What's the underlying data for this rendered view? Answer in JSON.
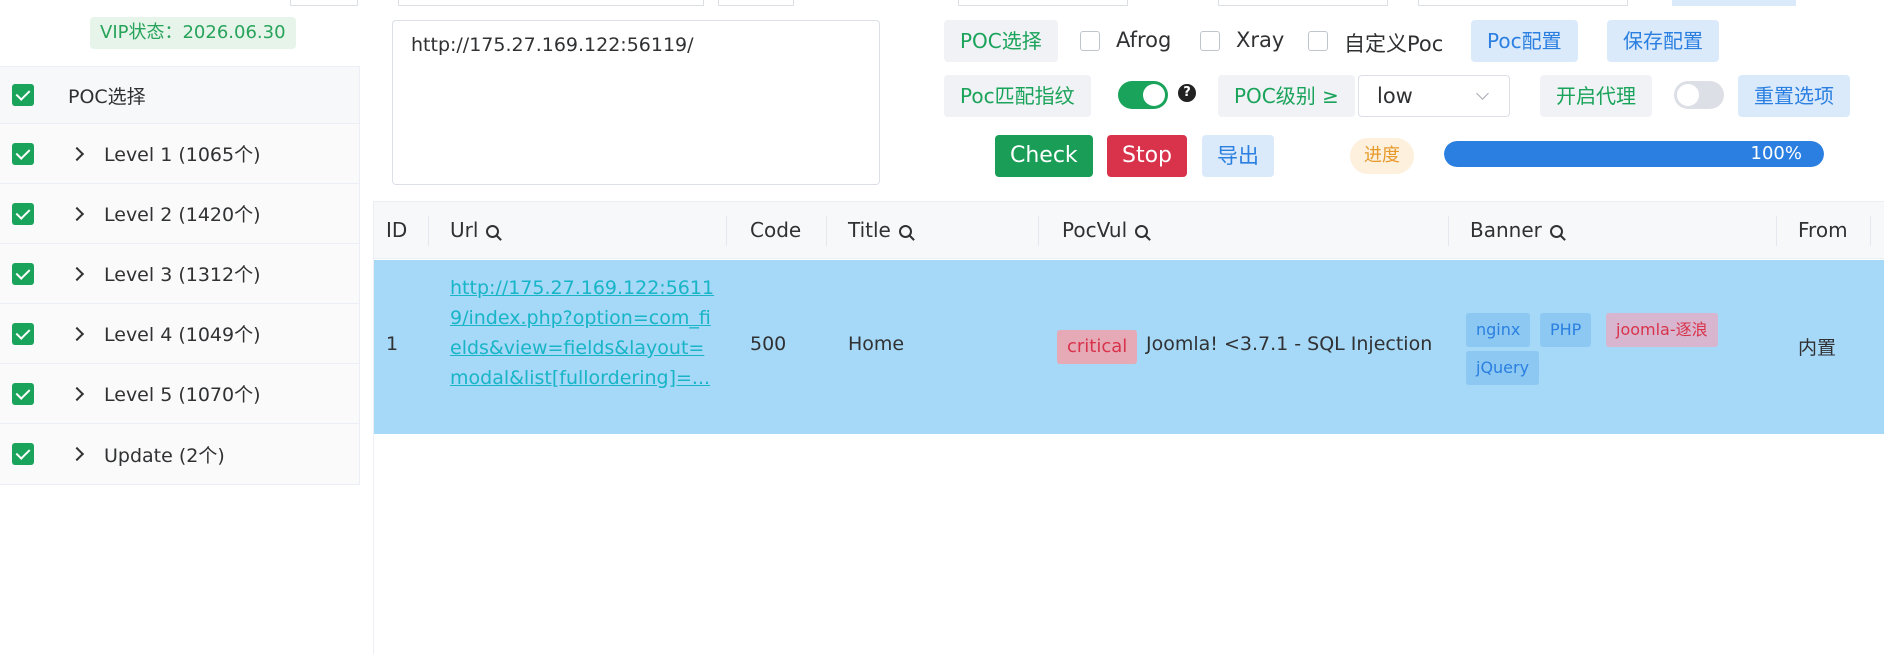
{
  "vip": {
    "label": "VIP状态：2026.06.30"
  },
  "tree": {
    "header": "POC选择",
    "items": [
      {
        "label": "Level 1 (1065个)"
      },
      {
        "label": "Level 2 (1420个)"
      },
      {
        "label": "Level 3 (1312个)"
      },
      {
        "label": "Level 4 (1049个)"
      },
      {
        "label": "Level 5 (1070个)"
      },
      {
        "label": "Update (2个)"
      }
    ]
  },
  "target": {
    "value": "http://175.27.169.122:56119/"
  },
  "toolbar": {
    "poc_select": "POC选择",
    "afrog": "Afrog",
    "xray": "Xray",
    "custom_poc": "自定义Poc",
    "poc_config": "Poc配置",
    "save_config": "保存配置",
    "poc_match": "Poc匹配指纹",
    "help": "?",
    "poc_level": "POC级别 ≥",
    "level_value": "low",
    "proxy": "开启代理",
    "reset": "重置选项",
    "check": "Check",
    "stop": "Stop",
    "export": "导出",
    "progress_label": "进度",
    "progress_text": "100%",
    "progress_value": 1.0
  },
  "table": {
    "columns": [
      "ID",
      "Url",
      "Code",
      "Title",
      "PocVul",
      "Banner",
      "From"
    ],
    "rows": [
      {
        "id": "1",
        "url": "http://175.27.169.122:56119/index.php?option=com_fields&view=fields&layout=modal&list[fullordering]=...",
        "code": "500",
        "title": "Home",
        "severity": "critical",
        "vul": "Joomla! <3.7.1 - SQL Injection",
        "banners": [
          "nginx",
          "PHP",
          "joomla-逐浪",
          "jQuery"
        ],
        "from": "内置"
      }
    ]
  },
  "colors": {
    "green": "#1aa35a",
    "red": "#d8334a",
    "blue": "#2a7fe0",
    "row_highlight": "#a6d8f7"
  }
}
